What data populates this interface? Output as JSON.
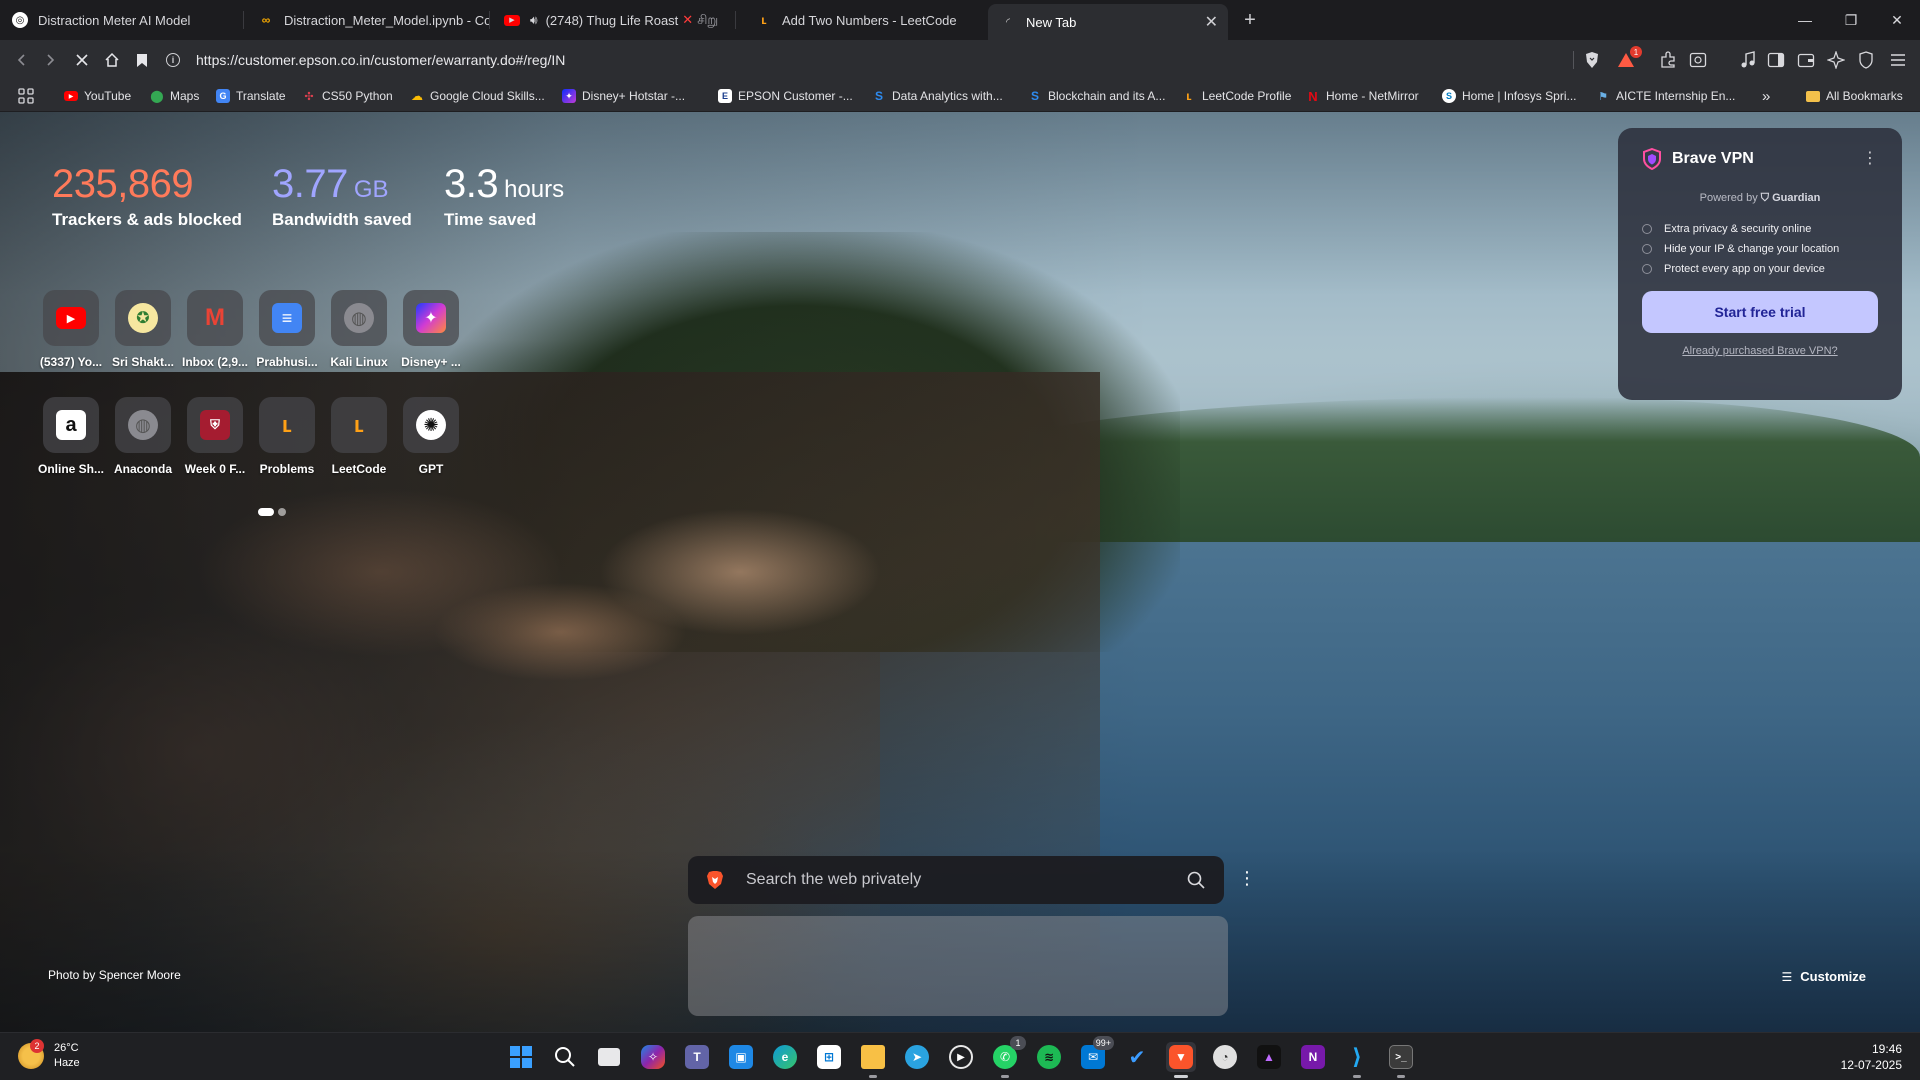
{
  "tabs": [
    {
      "title": "Distraction Meter AI Model",
      "icon": "chatgpt-icon"
    },
    {
      "title": "Distraction_Meter_Model.ipynb - Col",
      "icon": "colab-icon"
    },
    {
      "title": "(2748) Thug Life Roast",
      "icon": "youtube-icon",
      "suffix": "சிறு"
    },
    {
      "title": "Add Two Numbers - LeetCode",
      "icon": "leetcode-icon"
    },
    {
      "title": "New Tab",
      "icon": "loading-icon",
      "active": true
    }
  ],
  "address": {
    "url": "https://customer.epson.co.in/customer/ewarranty.do#/reg/IN"
  },
  "notifications": {
    "brave_rewards_badge": "1"
  },
  "bookmarks": [
    {
      "label": "YouTube",
      "icon": "youtube-icon",
      "color": "#ff0000"
    },
    {
      "label": "Maps",
      "icon": "maps-pin-icon",
      "color": "#34a853"
    },
    {
      "label": "Translate",
      "icon": "translate-icon",
      "color": "#4285f4"
    },
    {
      "label": "CS50 Python",
      "icon": "cs50-icon",
      "color": "#a51c30"
    },
    {
      "label": "Google Cloud Skills...",
      "icon": "google-cloud-icon",
      "color": "#fbbc05"
    },
    {
      "label": "Disney+ Hotstar -...",
      "icon": "hotstar-icon",
      "color": "#1f3bff"
    },
    {
      "label": "EPSON Customer -...",
      "icon": "epson-icon",
      "color": "#ffffff"
    },
    {
      "label": "Data Analytics with...",
      "icon": "analytics-icon",
      "color": "#0a66c2"
    },
    {
      "label": "Blockchain and its A...",
      "icon": "nptel-icon",
      "color": "#0a66c2"
    },
    {
      "label": "LeetCode Profile",
      "icon": "leetcode-icon",
      "color": "#ffa116"
    },
    {
      "label": "Home - NetMirror",
      "icon": "netmirror-icon",
      "color": "#e50914"
    },
    {
      "label": "Home | Infosys Spri...",
      "icon": "infosys-icon",
      "color": "#007cc3"
    },
    {
      "label": "AICTE Internship En...",
      "icon": "aicte-icon",
      "color": "#2d6a9f"
    }
  ],
  "bookmarks_overflow": "»",
  "all_bookmarks": "All Bookmarks",
  "stats": [
    {
      "value": "235,869",
      "unit": "",
      "label": "Trackers & ads blocked",
      "color": "#ff7a5a"
    },
    {
      "value": "3.77",
      "unit": "GB",
      "label": "Bandwidth saved",
      "color": "#a0a5ff"
    },
    {
      "value": "3.3",
      "unit": "hours",
      "label": "Time saved",
      "color": "#ffffff"
    }
  ],
  "top_sites": [
    {
      "name": "(5337) Yo...",
      "icon": "youtube-icon",
      "color": "#ff0000"
    },
    {
      "name": "Sri Shakt...",
      "icon": "college-crest-icon",
      "color": "#2e7d32"
    },
    {
      "name": "Inbox (2,9...",
      "icon": "gmail-icon",
      "color": "#ea4335"
    },
    {
      "name": "Prabhusi...",
      "icon": "docs-icon",
      "color": "#4285f4"
    },
    {
      "name": "Kali Linux",
      "icon": "globe-icon",
      "color": "#6b6b70"
    },
    {
      "name": "Disney+ ...",
      "icon": "hotstar-icon",
      "color": "#2a3bd8"
    },
    {
      "name": "Online Sh...",
      "icon": "amazon-icon",
      "color": "#ffffff"
    },
    {
      "name": "Anaconda",
      "icon": "globe-icon",
      "color": "#6b6b70"
    },
    {
      "name": "Week 0 F...",
      "icon": "harvard-icon",
      "color": "#a51c30"
    },
    {
      "name": "Problems",
      "icon": "leetcode-icon",
      "color": "#2a2a2a"
    },
    {
      "name": "LeetCode",
      "icon": "leetcode-icon",
      "color": "#2a2a2a"
    },
    {
      "name": "GPT",
      "icon": "chatgpt-icon",
      "color": "#ffffff"
    }
  ],
  "vpn": {
    "title": "Brave VPN",
    "powered_by": "Powered by",
    "partner": "Guardian",
    "features": [
      "Extra privacy & security online",
      "Hide your IP & change your location",
      "Protect every app on your device"
    ],
    "cta": "Start free trial",
    "already": "Already purchased Brave VPN?"
  },
  "search": {
    "placeholder": "Search the web privately"
  },
  "photo_credit": "Photo by Spencer Moore",
  "customize": "Customize",
  "taskbar": {
    "weather": {
      "temp": "26°C",
      "condition": "Haze",
      "badge": "2"
    },
    "apps": [
      {
        "name": "start-button",
        "color": "#3aa0ff"
      },
      {
        "name": "search-button",
        "color": "#ffffff"
      },
      {
        "name": "task-view-button",
        "color": "#ffffff"
      },
      {
        "name": "copilot-app",
        "color": "#7b61ff"
      },
      {
        "name": "teams-app",
        "color": "#6264a7"
      },
      {
        "name": "widgets-app",
        "color": "#1e88e5"
      },
      {
        "name": "edge-app",
        "color": "#0f9ad6"
      },
      {
        "name": "store-app",
        "color": "#ffb900"
      },
      {
        "name": "file-explorer-app",
        "color": "#f8c045"
      },
      {
        "name": "telegram-app",
        "color": "#2aa3e0"
      },
      {
        "name": "media-player-app",
        "color": "#e8e8e8"
      },
      {
        "name": "whatsapp-app",
        "color": "#25d366",
        "badge": "1"
      },
      {
        "name": "spotify-app",
        "color": "#1db954"
      },
      {
        "name": "mail-app",
        "color": "#0078d4",
        "badge": "99+"
      },
      {
        "name": "todo-app",
        "color": "#2564cf"
      },
      {
        "name": "brave-app",
        "color": "#fb542b"
      },
      {
        "name": "clock-app",
        "color": "#dcdcdc"
      },
      {
        "name": "affinity-app",
        "color": "#7b3fe4"
      },
      {
        "name": "onenote-app",
        "color": "#7719aa"
      },
      {
        "name": "vscode-app",
        "color": "#23a9f2"
      },
      {
        "name": "terminal-app",
        "color": "#3b3b3b"
      }
    ],
    "time": "19:46",
    "date": "12-07-2025"
  }
}
